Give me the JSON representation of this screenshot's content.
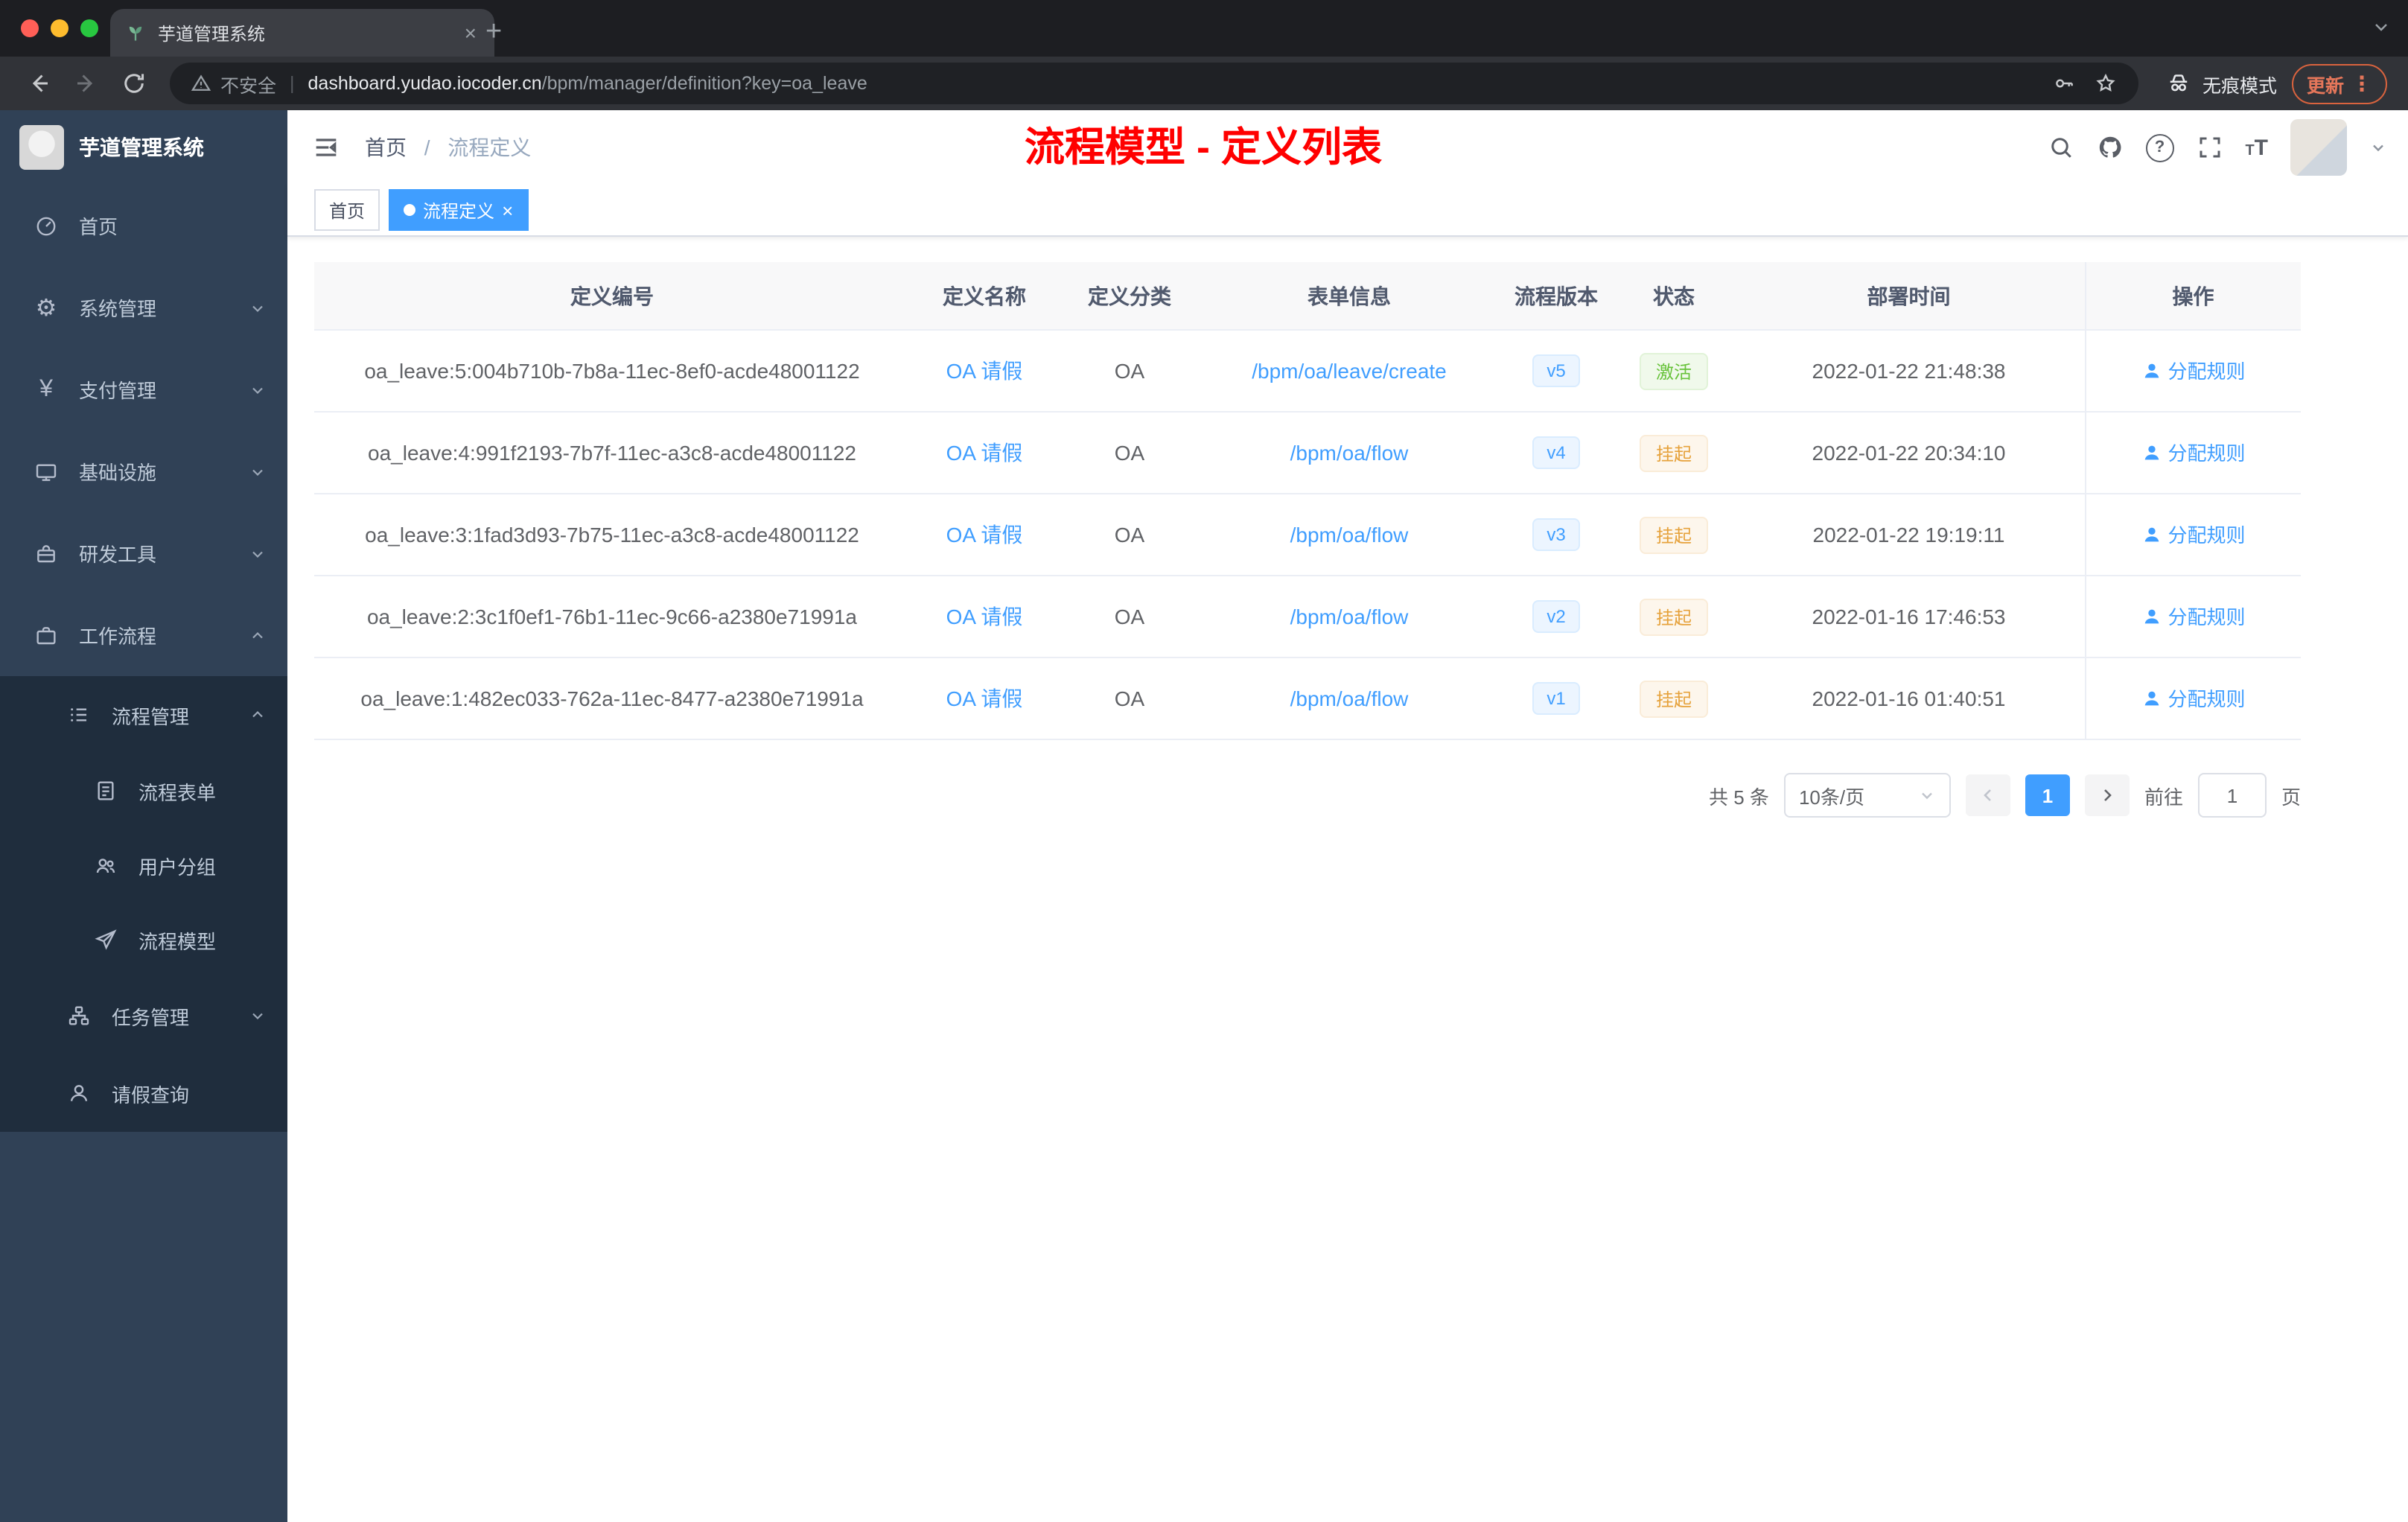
{
  "browser": {
    "tab": {
      "title": "芋道管理系统"
    },
    "address": {
      "security_label": "不安全",
      "domain": "dashboard.yudao.iocoder.cn",
      "path": "/bpm/manager/definition?key=oa_leave"
    },
    "incognito_label": "无痕模式",
    "update_label": "更新"
  },
  "sidebar": {
    "app_title": "芋道管理系统",
    "items": [
      {
        "label": "首页"
      },
      {
        "label": "系统管理"
      },
      {
        "label": "支付管理"
      },
      {
        "label": "基础设施"
      },
      {
        "label": "研发工具"
      },
      {
        "label": "工作流程"
      },
      {
        "label": "流程管理"
      },
      {
        "label": "流程表单"
      },
      {
        "label": "用户分组"
      },
      {
        "label": "流程模型"
      },
      {
        "label": "任务管理"
      },
      {
        "label": "请假查询"
      }
    ]
  },
  "header": {
    "breadcrumb": {
      "home": "首页",
      "separator": "/",
      "current": "流程定义"
    },
    "annotation": "流程模型 - 定义列表"
  },
  "tags": {
    "home": "首页",
    "active": "流程定义"
  },
  "table": {
    "columns": [
      "定义编号",
      "定义名称",
      "定义分类",
      "表单信息",
      "流程版本",
      "状态",
      "部署时间",
      "操作"
    ],
    "action_label": "分配规则",
    "rows": [
      {
        "id": "oa_leave:5:004b710b-7b8a-11ec-8ef0-acde48001122",
        "name": "OA 请假",
        "category": "OA",
        "form": "/bpm/oa/leave/create",
        "version": "v5",
        "status": "激活",
        "status_type": "success",
        "time": "2022-01-22 21:48:38"
      },
      {
        "id": "oa_leave:4:991f2193-7b7f-11ec-a3c8-acde48001122",
        "name": "OA 请假",
        "category": "OA",
        "form": "/bpm/oa/flow",
        "version": "v4",
        "status": "挂起",
        "status_type": "warning",
        "time": "2022-01-22 20:34:10"
      },
      {
        "id": "oa_leave:3:1fad3d93-7b75-11ec-a3c8-acde48001122",
        "name": "OA 请假",
        "category": "OA",
        "form": "/bpm/oa/flow",
        "version": "v3",
        "status": "挂起",
        "status_type": "warning",
        "time": "2022-01-22 19:19:11"
      },
      {
        "id": "oa_leave:2:3c1f0ef1-76b1-11ec-9c66-a2380e71991a",
        "name": "OA 请假",
        "category": "OA",
        "form": "/bpm/oa/flow",
        "version": "v2",
        "status": "挂起",
        "status_type": "warning",
        "time": "2022-01-16 17:46:53"
      },
      {
        "id": "oa_leave:1:482ec033-762a-11ec-8477-a2380e71991a",
        "name": "OA 请假",
        "category": "OA",
        "form": "/bpm/oa/flow",
        "version": "v1",
        "status": "挂起",
        "status_type": "warning",
        "time": "2022-01-16 01:40:51"
      }
    ]
  },
  "pagination": {
    "total": "共 5 条",
    "page_size": "10条/页",
    "current_page": "1",
    "goto_label": "前往",
    "goto_value": "1",
    "page_unit": "页"
  },
  "colors": {
    "primary": "#409eff",
    "success": "#67c23a",
    "warning": "#e6a23c",
    "annotation_red": "#ff0000",
    "sidebar_bg": "#304156",
    "submenu_bg": "#1f2d3d"
  }
}
